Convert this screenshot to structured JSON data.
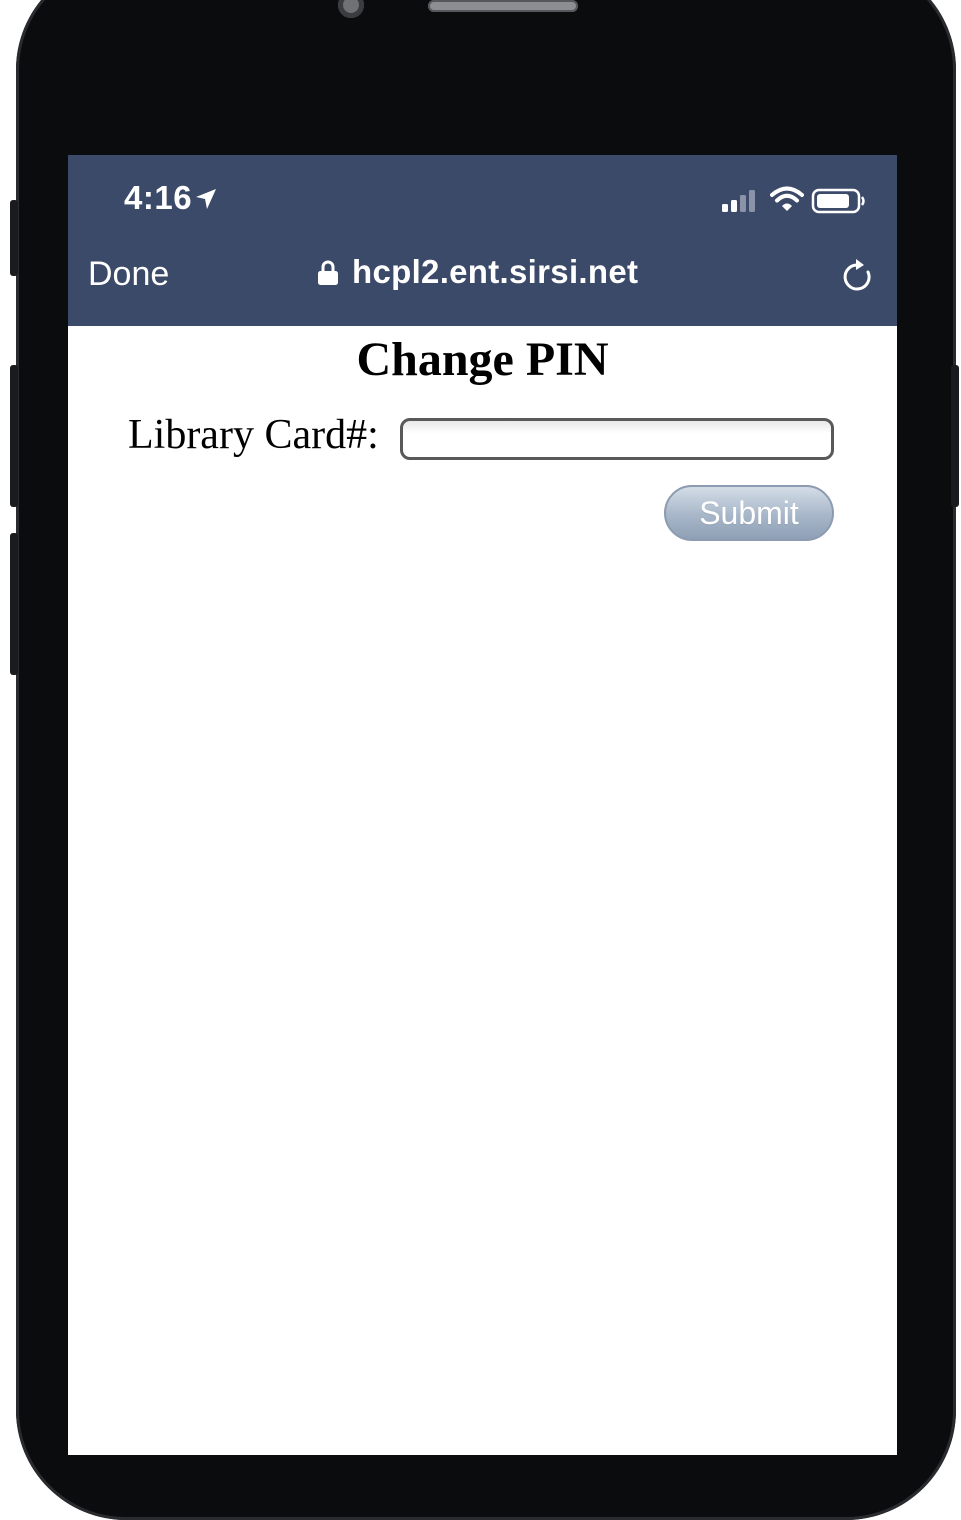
{
  "status_bar": {
    "time": "4:16",
    "icons": [
      "location-arrow-icon",
      "signal-icon",
      "wifi-icon",
      "battery-icon"
    ]
  },
  "browser_bar": {
    "done_label": "Done",
    "url": "hcpl2.ent.sirsi.net",
    "icons": [
      "lock-icon",
      "reload-icon"
    ]
  },
  "page": {
    "title": "Change PIN",
    "card_label": "Library Card#:",
    "card_value": "",
    "submit_label": "Submit"
  },
  "colors": {
    "browser_bar": "#3c4a69",
    "device_body": "#0b0c0e",
    "submit_button": "#a7b6c8"
  }
}
